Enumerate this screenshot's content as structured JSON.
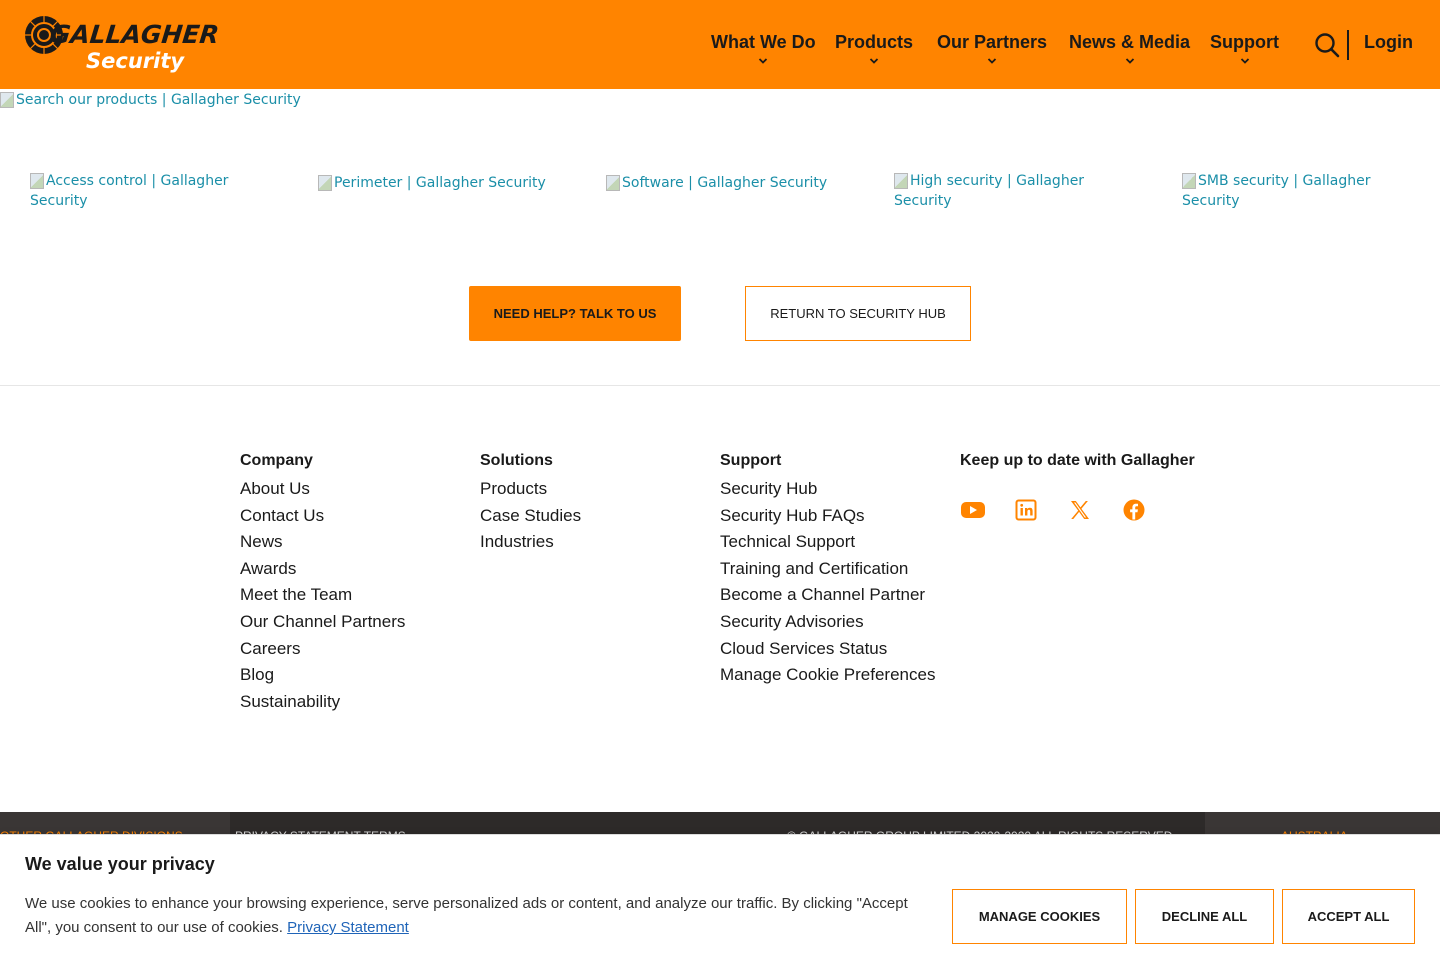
{
  "brand": {
    "name": "GALLAGHER",
    "sub": "Security",
    "tm": "™",
    "primary_color": "#ff8400"
  },
  "nav": {
    "items": [
      {
        "label": "What We Do"
      },
      {
        "label": "Products"
      },
      {
        "label": "Our Partners"
      },
      {
        "label": "News & Media"
      },
      {
        "label": "Support"
      }
    ],
    "search_icon": "search-icon",
    "login": "Login"
  },
  "banner_image": {
    "alt": "Search our products | Gallagher Security"
  },
  "categories": [
    {
      "alt_line1": "Access control | Gallagher",
      "alt_line2": "Security"
    },
    {
      "alt_line1": "Perimeter | Gallagher Security",
      "alt_line2": ""
    },
    {
      "alt_line1": "Software | Gallagher Security",
      "alt_line2": ""
    },
    {
      "alt_line1": "High security | Gallagher",
      "alt_line2": "Security"
    },
    {
      "alt_line1": "SMB security | Gallagher",
      "alt_line2": "Security"
    }
  ],
  "cta": {
    "primary": "NEED HELP? TALK TO US",
    "secondary": "RETURN TO SECURITY HUB"
  },
  "footer": {
    "company": {
      "heading": "Company",
      "links": [
        "About Us",
        "Contact Us",
        "News",
        "Awards",
        "Meet the Team",
        "Our Channel Partners",
        "Careers",
        "Blog",
        "Sustainability"
      ]
    },
    "solutions": {
      "heading": "Solutions",
      "links": [
        "Products",
        "Case Studies",
        "Industries"
      ]
    },
    "support": {
      "heading": "Support",
      "links": [
        "Security Hub",
        "Security Hub FAQs",
        "Technical Support",
        "Training and Certification",
        "Become a Channel Partner",
        "Security Advisories",
        "Cloud Services Status",
        "Manage Cookie Preferences"
      ]
    },
    "newsletter": {
      "heading": "Keep up to date with Gallagher",
      "social_icons": [
        "youtube-icon",
        "linkedin-icon",
        "x-icon",
        "facebook-icon"
      ]
    }
  },
  "bottom_bar": {
    "divisions": "OTHER GALLAGHER DIVISIONS",
    "legal": "PRIVACY STATEMENT  TERMS",
    "copyright": "© GALLAGHER GROUP LIMITED 2020-2020 ALL RIGHTS RESERVED",
    "region": "AUSTRALIA"
  },
  "cookie": {
    "title": "We value your privacy",
    "text": "We use cookies to enhance your browsing experience, serve personalized ads or content, and analyze our traffic. By clicking \"Accept All\", you consent to our use of cookies.",
    "link": "Privacy Statement",
    "manage": "MANAGE COOKIES",
    "decline": "DECLINE ALL",
    "accept": "ACCEPT ALL"
  }
}
